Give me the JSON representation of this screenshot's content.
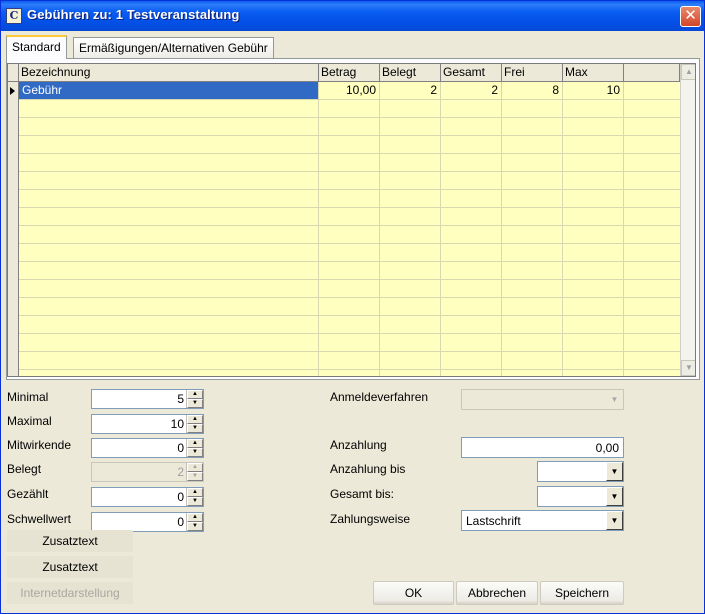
{
  "window": {
    "title": "Gebühren zu: 1 Testveranstaltung",
    "app_icon": "app-logo-icon",
    "close_glyph": "✕"
  },
  "tabs": [
    {
      "label": "Standard",
      "active": true
    },
    {
      "label": "Ermäßigungen/Alternativen Gebühr",
      "active": false
    }
  ],
  "grid": {
    "columns": [
      "Bezeichnung",
      "Betrag",
      "Belegt",
      "Gesamt",
      "Frei",
      "Max"
    ],
    "rows": [
      {
        "Bezeichnung": "Gebühr",
        "Betrag": "10,00",
        "Belegt": "2",
        "Gesamt": "2",
        "Frei": "8",
        "Max": "10"
      }
    ]
  },
  "form": {
    "minimal": {
      "label": "Minimal",
      "value": "5"
    },
    "maximal": {
      "label": "Maximal",
      "value": "10"
    },
    "mitwirkende": {
      "label": "Mitwirkende",
      "value": "0"
    },
    "belegt": {
      "label": "Belegt",
      "value": "2"
    },
    "gezaehlt": {
      "label": "Gezählt",
      "value": "0"
    },
    "schwellwert": {
      "label": "Schwellwert",
      "value": "0"
    },
    "anmeldeverfahren": {
      "label": "Anmeldeverfahren",
      "value": ""
    },
    "anzahlung": {
      "label": "Anzahlung",
      "value": "0,00"
    },
    "anzahlung_bis": {
      "label": "Anzahlung bis",
      "value": ""
    },
    "gesamt_bis": {
      "label": "Gesamt bis:",
      "value": ""
    },
    "zahlungsweise": {
      "label": "Zahlungsweise",
      "value": "Lastschrift"
    }
  },
  "buttons": {
    "zusatztext1": "Zusatztext",
    "zusatztext2": "Zusatztext",
    "internetdarstellung": "Internetdarstellung",
    "ok": "OK",
    "abbrechen": "Abbrechen",
    "speichern": "Speichern"
  }
}
